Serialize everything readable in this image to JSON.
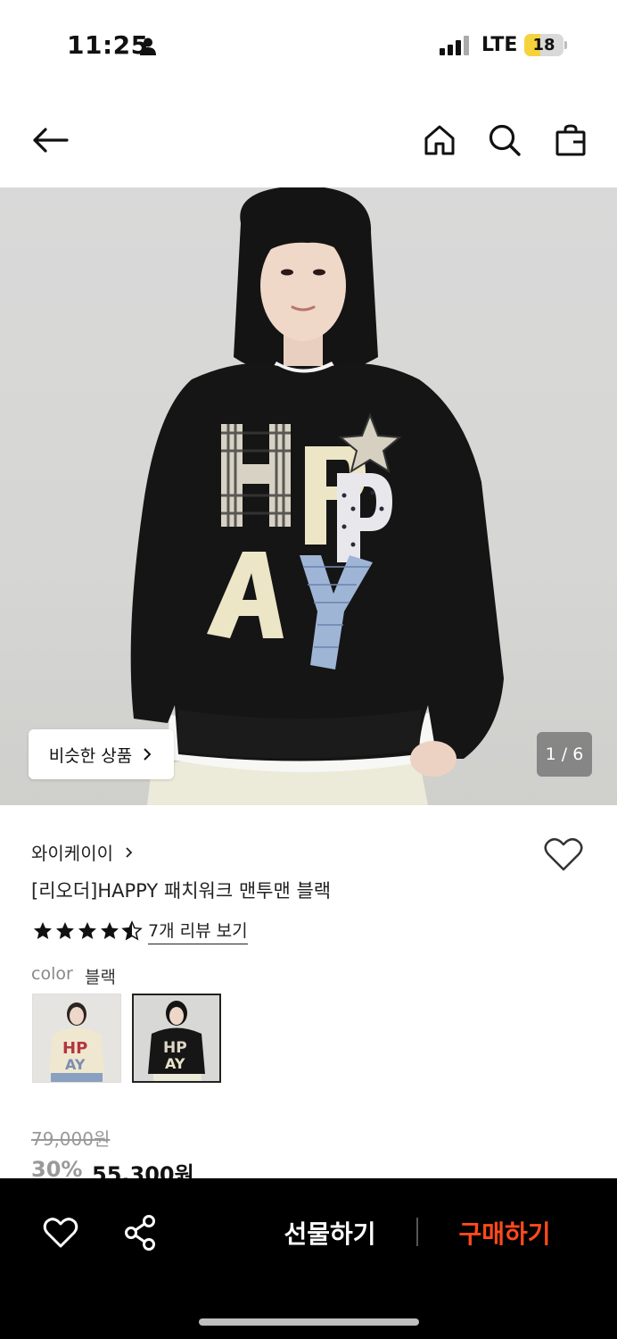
{
  "status_bar": {
    "time": "11:25",
    "network": "LTE",
    "battery": "18"
  },
  "nav": {
    "back_icon": "arrow-left-icon",
    "home_icon": "home-icon",
    "search_icon": "search-icon",
    "bag_icon": "shopping-bag-icon"
  },
  "hero": {
    "similar_label": "비슷한 상품",
    "pager": "1 / 6",
    "sweater_letters": "HAPPY"
  },
  "product": {
    "brand": "와이케이이",
    "title": "[리오더]HAPPY 패치워크 맨투맨 블랙",
    "rating": 4.5,
    "review_link": "7개 리뷰 보기",
    "color_label": "color",
    "color_value": "블랙",
    "swatches": [
      "cream",
      "black"
    ],
    "original_price": "79,000원",
    "discount": "30%",
    "sale_price": "55,300원"
  },
  "bottom_bar": {
    "gift_label": "선물하기",
    "buy_label": "구매하기"
  },
  "colors": {
    "accent": "#ff4a1c",
    "bottom_bar": "#000000"
  }
}
